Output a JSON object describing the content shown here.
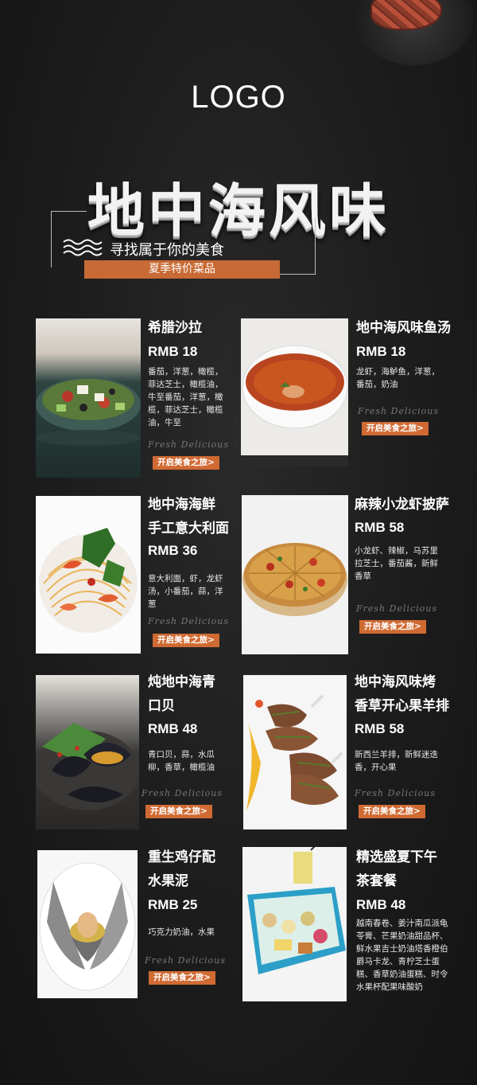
{
  "header": {
    "logo": "LOGO",
    "title": "地中海风味",
    "subtitle": "寻找属于你的美食",
    "season_label": "夏季特价菜品"
  },
  "colors": {
    "background": "#1c1c1c",
    "accent": "#d06a33",
    "text": "#ffffff"
  },
  "common": {
    "script_text": "Fresh Delicious",
    "button_label": "开启美食之旅>"
  },
  "dishes": [
    {
      "name_lines": [
        "希腊沙拉"
      ],
      "price": "RMB 18",
      "desc": "番茄，洋葱，橄榄，菲达芝士，橄榄油，牛至番茄，洋葱，橄榄，菲达芝士，橄榄油，牛至",
      "photo_icon": "greek-salad-photo"
    },
    {
      "name_lines": [
        "地中海风味鱼汤"
      ],
      "price": "RMB 18",
      "desc": "龙虾，海鲈鱼，洋葱，番茄，奶油",
      "photo_icon": "fish-soup-photo"
    },
    {
      "name_lines": [
        "地中海海鲜",
        "手工意大利面"
      ],
      "price": "RMB 36",
      "desc": "意大利面，虾，龙虾汤，小番茄，蒜，洋葱",
      "photo_icon": "seafood-pasta-photo"
    },
    {
      "name_lines": [
        "麻辣小龙虾披萨"
      ],
      "price": "RMB 58",
      "desc": "小龙虾、辣椒，马苏里拉芝士，番茄酱，新鲜香草",
      "photo_icon": "crayfish-pizza-photo"
    },
    {
      "name_lines": [
        "炖地中海青",
        "口贝"
      ],
      "price": "RMB 48",
      "desc": "青口贝，蒜，水瓜柳，香草，橄榄油",
      "photo_icon": "mussels-photo"
    },
    {
      "name_lines": [
        "地中海风味烤",
        "香草开心果羊排"
      ],
      "price": "RMB 58",
      "desc": "新西兰羊排，新鲜迷迭香，开心果",
      "photo_icon": "lamb-chops-photo"
    },
    {
      "name_lines": [
        "重生鸡仔配",
        "水果泥"
      ],
      "price": "RMB 25",
      "desc": "巧克力奶油，水果",
      "photo_icon": "egg-dessert-photo"
    },
    {
      "name_lines": [
        "精选盛夏下午",
        "茶套餐"
      ],
      "price": "RMB 48",
      "desc": "越南春卷、姜汁南瓜派龟苓膏、芒果奶油甜品杯、鲜水果吉士奶油塔香橙伯爵马卡龙、青柠芝士蛋糕、香草奶油蛋糕、时令水果杯配果味酸奶",
      "photo_icon": "afternoon-tea-photo"
    }
  ]
}
